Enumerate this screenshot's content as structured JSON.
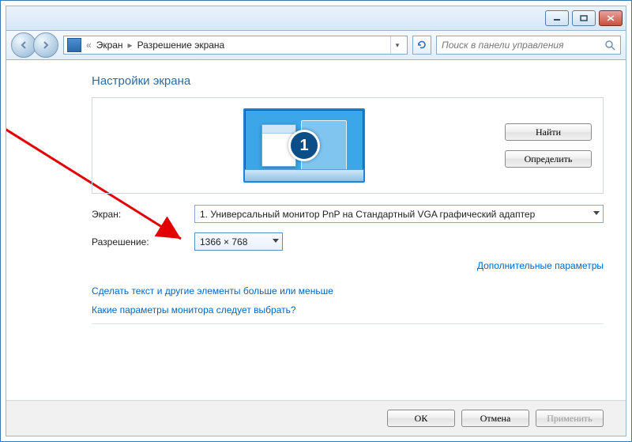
{
  "breadcrumb": [
    "Экран",
    "Разрешение экрана"
  ],
  "search": {
    "placeholder": "Поиск в панели управления"
  },
  "title": "Настройки экрана",
  "monitor": {
    "number": "1"
  },
  "labels": {
    "display": "Экран:",
    "resolution": "Разрешение:"
  },
  "fields": {
    "display": "1. Универсальный монитор PnP на Стандартный VGA графический адаптер",
    "resolution": "1366 × 768"
  },
  "buttons": {
    "detect": "Найти",
    "identify": "Определить",
    "ok": "ОК",
    "cancel": "Отмена",
    "apply": "Применить"
  },
  "links": {
    "advanced": "Дополнительные параметры",
    "textsize": "Сделать текст и другие элементы больше или меньше",
    "monitorhelp": "Какие параметры монитора следует выбрать?"
  }
}
